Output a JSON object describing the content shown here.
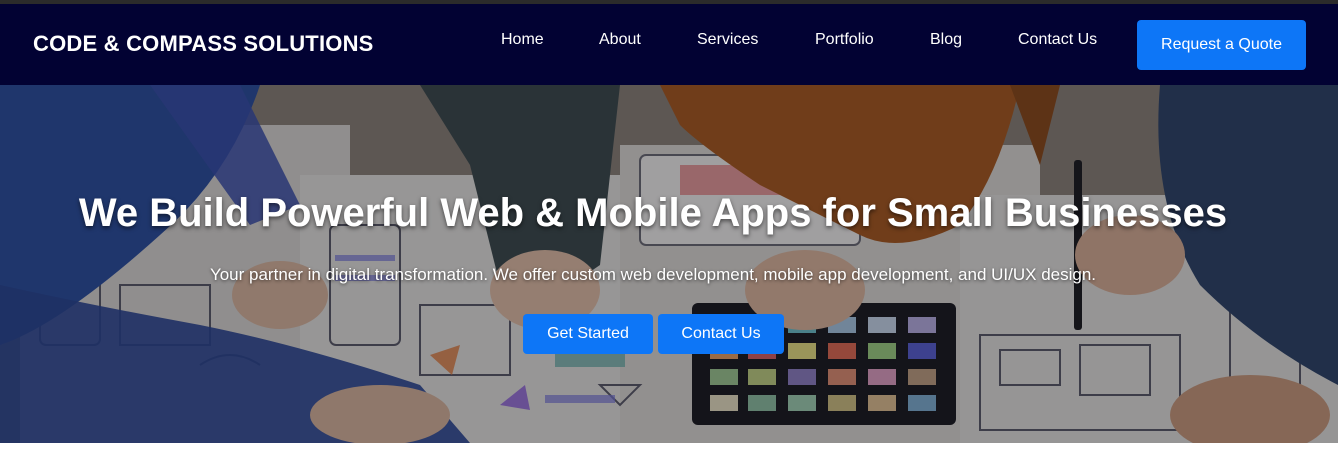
{
  "header": {
    "brand": "CODE & COMPASS SOLUTIONS",
    "nav": [
      {
        "label": "Home"
      },
      {
        "label": "About"
      },
      {
        "label": "Services"
      },
      {
        "label": "Portfolio"
      },
      {
        "label": "Blog"
      },
      {
        "label": "Contact Us"
      }
    ],
    "cta_label": "Request a Quote"
  },
  "hero": {
    "title": "We Build Powerful Web & Mobile Apps for Small Businesses",
    "subtitle": "Your partner in digital transformation. We offer custom web development, mobile app development, and UI/UX design.",
    "primary_button": "Get Started",
    "secondary_button": "Contact Us",
    "background_image": "team-planning-ui-wireframes-photo"
  },
  "colors": {
    "navbar_bg": "#020233",
    "accent": "#0d76f7",
    "text_light": "#ffffff"
  }
}
